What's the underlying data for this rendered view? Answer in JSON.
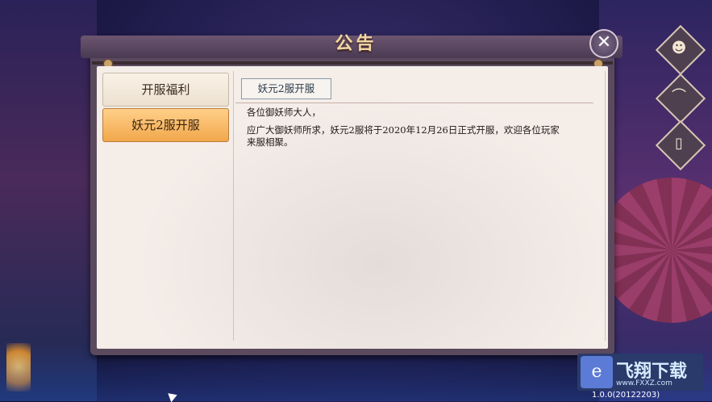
{
  "dialog": {
    "title": "公告",
    "close_label": "✕"
  },
  "sidebar": {
    "tabs": [
      {
        "label": "开服福利",
        "active": false
      },
      {
        "label": "妖元2服开服",
        "active": true
      }
    ]
  },
  "content": {
    "tab_label": "妖元2服开服",
    "greeting": "各位御妖师大人，",
    "body_line1": "应广大御妖师所求，妖元2服将于2020年12月26日正式开服，欢迎各位玩家",
    "body_line2": "来服相聚。"
  },
  "side_buttons": [
    {
      "icon": "portrait-icon",
      "glyph": "☻"
    },
    {
      "icon": "fan-icon",
      "glyph": "⌒"
    },
    {
      "icon": "scroll-icon",
      "glyph": "▯"
    }
  ],
  "watermark": {
    "title": "飞翔下载",
    "url": "www.FXXZ.com"
  },
  "version": "1.0.0(20122203)",
  "colors": {
    "active_tab": "#f1a84a",
    "panel": "#f4ede8",
    "frame": "#5b4a5e",
    "title": "#f2d7a3"
  }
}
